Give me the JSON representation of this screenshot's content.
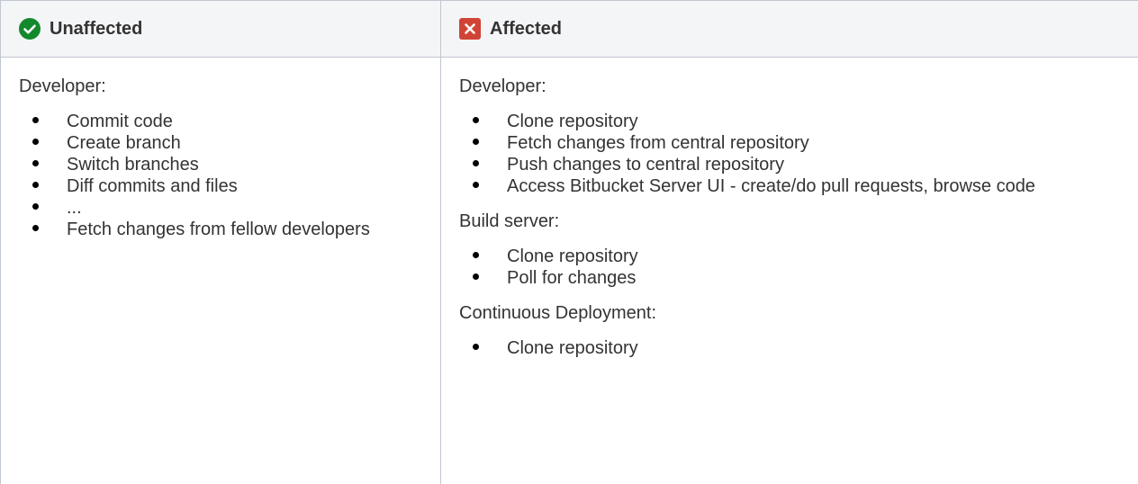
{
  "columns": {
    "unaffected": {
      "header": "Unaffected",
      "icon": "check-circle-icon",
      "icon_color": "#14892c",
      "sections": [
        {
          "label": "Developer:",
          "items": [
            "Commit code",
            "Create branch",
            "Switch branches",
            "Diff commits and files",
            "...",
            "Fetch changes from fellow developers"
          ]
        }
      ]
    },
    "affected": {
      "header": "Affected",
      "icon": "cross-box-icon",
      "icon_color": "#d04437",
      "sections": [
        {
          "label": "Developer:",
          "items": [
            "Clone repository",
            "Fetch changes from central repository",
            "Push changes to central repository",
            "Access Bitbucket Server UI - create/do pull requests, browse code"
          ]
        },
        {
          "label": "Build server:",
          "items": [
            "Clone repository",
            "Poll for changes"
          ]
        },
        {
          "label": "Continuous Deployment:",
          "items": [
            "Clone repository"
          ]
        }
      ]
    }
  }
}
